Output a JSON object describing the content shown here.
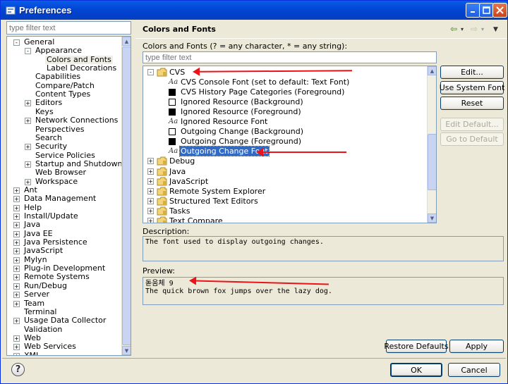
{
  "window": {
    "title": "Preferences"
  },
  "left": {
    "filter_placeholder": "type filter text",
    "tree": [
      {
        "label": "General",
        "level": 0,
        "exp": "-"
      },
      {
        "label": "Appearance",
        "level": 1,
        "exp": "-"
      },
      {
        "label": "Colors and Fonts",
        "level": 2,
        "exp": "",
        "selected": true
      },
      {
        "label": "Label Decorations",
        "level": 2,
        "exp": ""
      },
      {
        "label": "Capabilities",
        "level": 1,
        "exp": ""
      },
      {
        "label": "Compare/Patch",
        "level": 1,
        "exp": ""
      },
      {
        "label": "Content Types",
        "level": 1,
        "exp": ""
      },
      {
        "label": "Editors",
        "level": 1,
        "exp": "+"
      },
      {
        "label": "Keys",
        "level": 1,
        "exp": ""
      },
      {
        "label": "Network Connections",
        "level": 1,
        "exp": "+"
      },
      {
        "label": "Perspectives",
        "level": 1,
        "exp": ""
      },
      {
        "label": "Search",
        "level": 1,
        "exp": ""
      },
      {
        "label": "Security",
        "level": 1,
        "exp": "+"
      },
      {
        "label": "Service Policies",
        "level": 1,
        "exp": ""
      },
      {
        "label": "Startup and Shutdown",
        "level": 1,
        "exp": "+"
      },
      {
        "label": "Web Browser",
        "level": 1,
        "exp": ""
      },
      {
        "label": "Workspace",
        "level": 1,
        "exp": "+"
      },
      {
        "label": "Ant",
        "level": 0,
        "exp": "+"
      },
      {
        "label": "Data Management",
        "level": 0,
        "exp": "+"
      },
      {
        "label": "Help",
        "level": 0,
        "exp": "+"
      },
      {
        "label": "Install/Update",
        "level": 0,
        "exp": "+"
      },
      {
        "label": "Java",
        "level": 0,
        "exp": "+"
      },
      {
        "label": "Java EE",
        "level": 0,
        "exp": "+"
      },
      {
        "label": "Java Persistence",
        "level": 0,
        "exp": "+"
      },
      {
        "label": "JavaScript",
        "level": 0,
        "exp": "+"
      },
      {
        "label": "Mylyn",
        "level": 0,
        "exp": "+"
      },
      {
        "label": "Plug-in Development",
        "level": 0,
        "exp": "+"
      },
      {
        "label": "Remote Systems",
        "level": 0,
        "exp": "+"
      },
      {
        "label": "Run/Debug",
        "level": 0,
        "exp": "+"
      },
      {
        "label": "Server",
        "level": 0,
        "exp": "+"
      },
      {
        "label": "Team",
        "level": 0,
        "exp": "+"
      },
      {
        "label": "Terminal",
        "level": 0,
        "exp": ""
      },
      {
        "label": "Usage Data Collector",
        "level": 0,
        "exp": "+"
      },
      {
        "label": "Validation",
        "level": 0,
        "exp": ""
      },
      {
        "label": "Web",
        "level": 0,
        "exp": "+"
      },
      {
        "label": "Web Services",
        "level": 0,
        "exp": "+"
      },
      {
        "label": "XML",
        "level": 0,
        "exp": "+"
      }
    ]
  },
  "page": {
    "title": "Colors and Fonts",
    "colors_fonts_label": "Colors and Fonts (? = any character, * = any string):",
    "filter_placeholder": "type filter text",
    "tree": [
      {
        "label": "CVS",
        "kind": "folder",
        "exp": "-",
        "level": 0
      },
      {
        "label": "CVS Console Font (set to default: Text Font)",
        "kind": "font",
        "level": 1
      },
      {
        "label": "CVS History Page Categories (Foreground)",
        "kind": "black",
        "level": 1
      },
      {
        "label": "Ignored Resource (Background)",
        "kind": "white",
        "level": 1
      },
      {
        "label": "Ignored Resource (Foreground)",
        "kind": "black",
        "level": 1
      },
      {
        "label": "Ignored Resource Font",
        "kind": "font",
        "level": 1
      },
      {
        "label": "Outgoing Change (Background)",
        "kind": "white",
        "level": 1
      },
      {
        "label": "Outgoing Change (Foreground)",
        "kind": "black",
        "level": 1
      },
      {
        "label": "Outgoing Change Font",
        "kind": "font",
        "level": 1,
        "selected": true
      },
      {
        "label": "Debug",
        "kind": "folder",
        "exp": "+",
        "level": 0
      },
      {
        "label": "Java",
        "kind": "folder",
        "exp": "+",
        "level": 0
      },
      {
        "label": "JavaScript",
        "kind": "folder",
        "exp": "+",
        "level": 0
      },
      {
        "label": "Remote System Explorer",
        "kind": "folder",
        "exp": "+",
        "level": 0
      },
      {
        "label": "Structured Text Editors",
        "kind": "folder",
        "exp": "+",
        "level": 0
      },
      {
        "label": "Tasks",
        "kind": "folder",
        "exp": "+",
        "level": 0
      },
      {
        "label": "Text Compare",
        "kind": "folder",
        "exp": "+",
        "level": 0
      }
    ],
    "buttons": {
      "edit": "Edit...",
      "use_system_font": "Use System Font",
      "reset": "Reset",
      "edit_default": "Edit Default...",
      "go_to_default": "Go to Default"
    },
    "description_label": "Description:",
    "description_text": "The font used to display outgoing changes.",
    "preview_label": "Preview:",
    "preview_line1": "돋움체 9",
    "preview_line2": "The quick brown fox jumps over the lazy dog.",
    "restore_defaults": "Restore Defaults",
    "apply": "Apply"
  },
  "footer": {
    "ok": "OK",
    "cancel": "Cancel",
    "help_glyph": "?"
  },
  "colors": {
    "selection": "#316ac5",
    "annotation_arrow": "#e8141a",
    "title_bar": "#0246d6"
  }
}
